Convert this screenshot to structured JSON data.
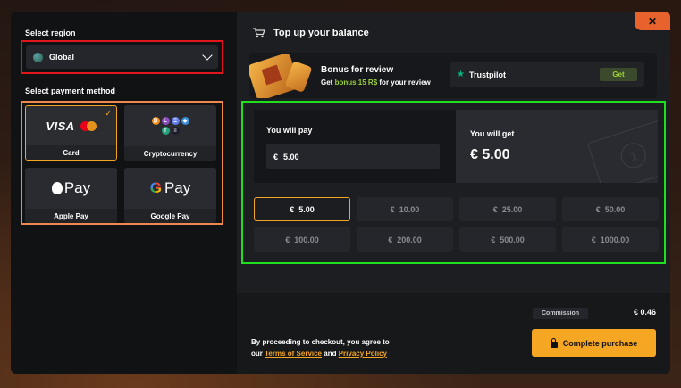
{
  "left": {
    "region_title": "Select region",
    "region_value": "Global",
    "payment_title": "Select payment method",
    "methods": [
      {
        "label": "Card",
        "logo_text": "VISA"
      },
      {
        "label": "Cryptocurrency"
      },
      {
        "label": "Apple Pay",
        "logo_text": "Pay"
      },
      {
        "label": "Google Pay",
        "logo_text": "Pay"
      }
    ],
    "selected_method": "Card"
  },
  "right": {
    "title": "Top up your balance",
    "close_label": "✕",
    "bonus": {
      "title": "Bonus for review",
      "sub_prefix": "Get",
      "sub_highlight": "bonus 15 R$",
      "sub_suffix": "for your review",
      "trustpilot_label": "Trustpilot",
      "get_label": "Get"
    },
    "pay": {
      "label": "You will pay",
      "currency": "€",
      "value": "5.00"
    },
    "get": {
      "label": "You will get",
      "value": "€ 5.00"
    },
    "amounts": [
      {
        "cur": "€",
        "val": "5.00"
      },
      {
        "cur": "€",
        "val": "10.00"
      },
      {
        "cur": "€",
        "val": "25.00"
      },
      {
        "cur": "€",
        "val": "50.00"
      },
      {
        "cur": "€",
        "val": "100.00"
      },
      {
        "cur": "€",
        "val": "200.00"
      },
      {
        "cur": "€",
        "val": "500.00"
      },
      {
        "cur": "€",
        "val": "1000.00"
      }
    ],
    "selected_amount": "5.00",
    "commission_label": "Commission",
    "commission_value": "€ 0.46",
    "terms_prefix": "By proceeding to checkout, you agree to",
    "terms_our": "our",
    "terms_link1": "Terms of Service",
    "terms_and": "and",
    "terms_link2": "Privacy Policy",
    "purchase_label": "Complete purchase"
  },
  "colors": {
    "accent": "#f5a623",
    "bonus_green": "#9bd13a",
    "trustpilot_green": "#00b67a",
    "highlight_red": "#e0161b",
    "highlight_orange": "#f0884e",
    "highlight_green": "#1fe01f"
  },
  "icons": [
    "globe-icon",
    "chevron-down-icon",
    "check-icon",
    "cart-icon",
    "close-icon",
    "star-icon",
    "lock-icon",
    "banknote-icon"
  ]
}
